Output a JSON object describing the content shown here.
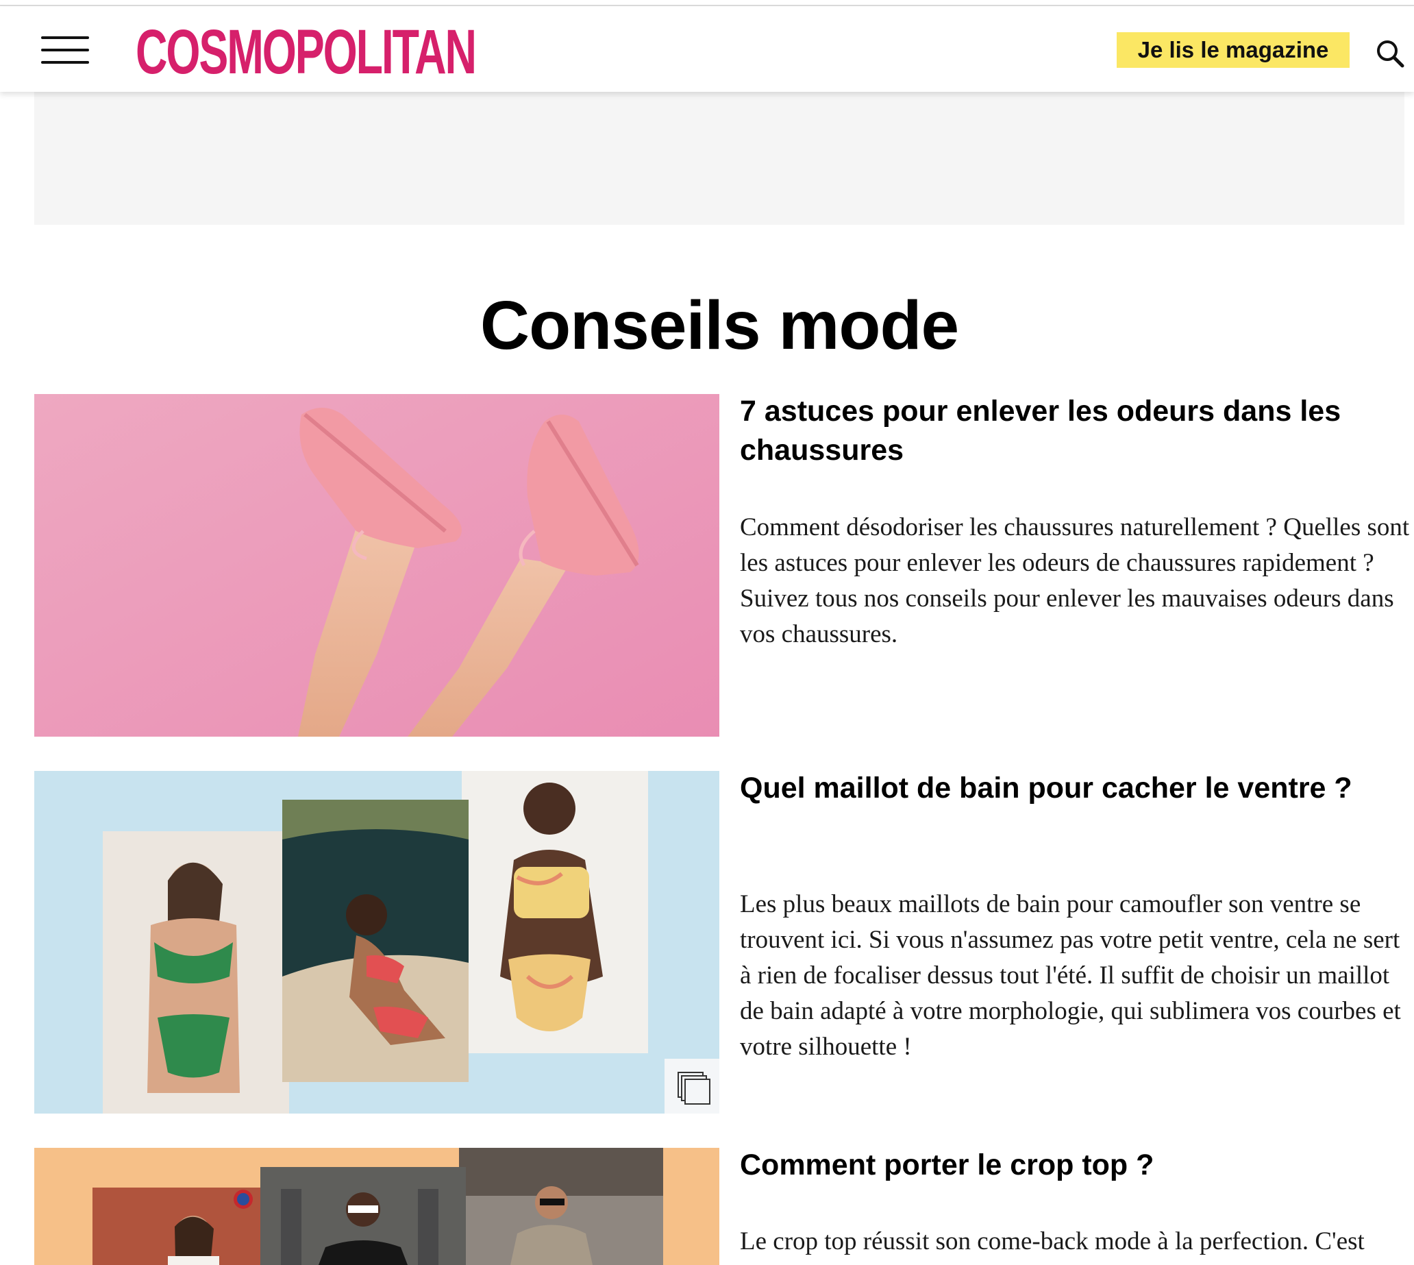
{
  "header": {
    "logo_text": "COSMOPOLITAN",
    "magazine_button": "Je lis le magazine",
    "menu_icon": "hamburger-menu-icon",
    "search_icon": "search-icon"
  },
  "colors": {
    "brand": "#d6206b",
    "magazine_button_bg": "#fbe764",
    "ad_placeholder_bg": "#f5f5f5"
  },
  "section": {
    "title": "Conseils mode"
  },
  "articles": [
    {
      "title": "7 astuces pour enlever les odeurs dans les chaussures",
      "description": "Comment désodoriser les chaussures naturellement ? Quelles sont les astuces pour enlever les odeurs de chaussures rapidement ? Suivez tous nos conseils pour enlever les mauvaises odeurs dans vos chaussures.",
      "image": "pink-sneakers-legs-photo"
    },
    {
      "title": "Quel maillot de bain pour cacher le ventre ?",
      "description": "Les plus beaux maillots de bain pour camoufler son ventre se trouvent ici. Si vous n'assumez pas votre petit ventre, cela ne sert à rien de focaliser dessus tout l'été. Il suffit de choisir un maillot de bain adapté à votre morphologie, qui sublimera vos courbes et votre silhouette !",
      "image": "swimsuit-collage-photo",
      "badge_icon": "gallery-icon"
    },
    {
      "title": "Comment porter le crop top ?",
      "description": "Le crop top réussit son come-back mode à la perfection. C'est",
      "image": "crop-top-street-style-collage"
    }
  ]
}
